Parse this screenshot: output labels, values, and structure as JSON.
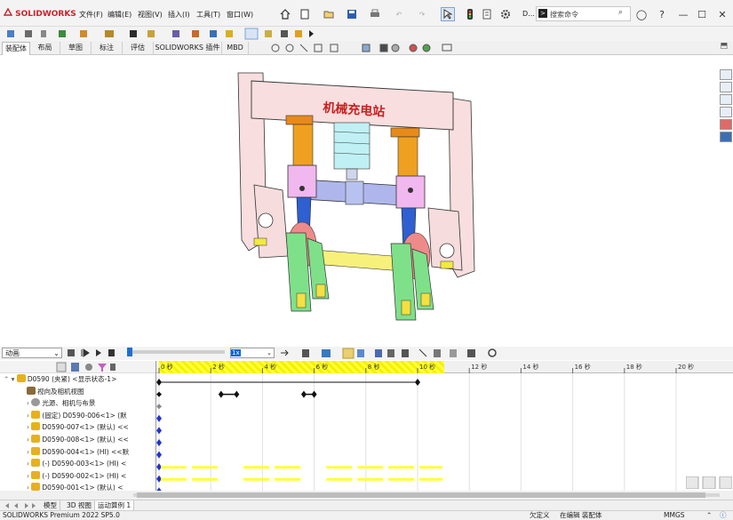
{
  "app": {
    "brand": "SOLIDWORKS",
    "command_prefix": "D..."
  },
  "menu": [
    "文件(F)",
    "编辑(E)",
    "视图(V)",
    "插入(I)",
    "工具(T)",
    "窗口(W)"
  ],
  "search": {
    "placeholder": "搜索命令"
  },
  "tabs": [
    "装配体",
    "布局",
    "草图",
    "标注",
    "评估",
    "SOLIDWORKS 插件",
    "MBD"
  ],
  "model": {
    "banner_text": "机械充电站"
  },
  "motion": {
    "study_type": "动画",
    "speed": "1x",
    "time_ticks": [
      "0 秒",
      "2 秒",
      "4 秒",
      "6 秒",
      "8 秒",
      "10 秒",
      "12 秒",
      "14 秒",
      "16 秒",
      "18 秒",
      "20 秒"
    ],
    "tree": [
      {
        "label": "D0590 (夹紧) <显示状态-1>",
        "icon": "assembly-icon"
      },
      {
        "label": "视向及相机视图",
        "icon": "camera-icon"
      },
      {
        "label": "光源、相机与布景",
        "icon": "light-icon"
      },
      {
        "label": "(固定) D0590-006<1> (默",
        "icon": "part-icon"
      },
      {
        "label": "D0590-007<1> (默认) <<",
        "icon": "part-icon"
      },
      {
        "label": "D0590-008<1> (默认) <<",
        "icon": "part-icon"
      },
      {
        "label": "D0590-004<1> (HI) <<默",
        "icon": "part-icon"
      },
      {
        "label": "(-) D0590-003<1> (HI) <",
        "icon": "part-icon"
      },
      {
        "label": "(-) D0590-002<1> (HI) <",
        "icon": "part-icon"
      },
      {
        "label": "D0590-001<1> (默认) <",
        "icon": "part-icon"
      }
    ],
    "duration_s": 10
  },
  "bottom_tabs": [
    "模型",
    "3D 视图",
    "运动算例 1"
  ],
  "status": {
    "product": "SOLIDWORKS Premium 2022 SP5.0",
    "constraint": "欠定义",
    "editing": "在编辑 装配体",
    "units": "MMGS"
  },
  "colors": {
    "brand_red": "#d0202a",
    "timeline_yellow": "#ffff3c",
    "key_blue": "#2234c8",
    "accent_blue": "#0a64d8"
  }
}
